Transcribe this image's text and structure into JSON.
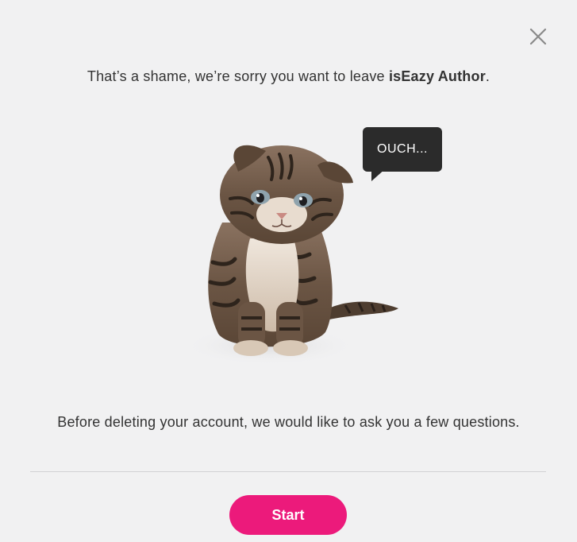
{
  "dialog": {
    "headline_prefix": "That’s a shame, we’re sorry you want to leave ",
    "app_name": "isEazy Author",
    "headline_suffix": ".",
    "illustration": {
      "subject": "kitten-illustration",
      "bubble_text": "OUCH..."
    },
    "body_text": "Before deleting your account, we would like to ask you a few questions.",
    "start_label": "Start",
    "close_icon": "close-icon"
  },
  "colors": {
    "background": "#f1f1f2",
    "accent": "#ec1a7b",
    "bubble": "#2b2b2b",
    "text": "#333333"
  }
}
